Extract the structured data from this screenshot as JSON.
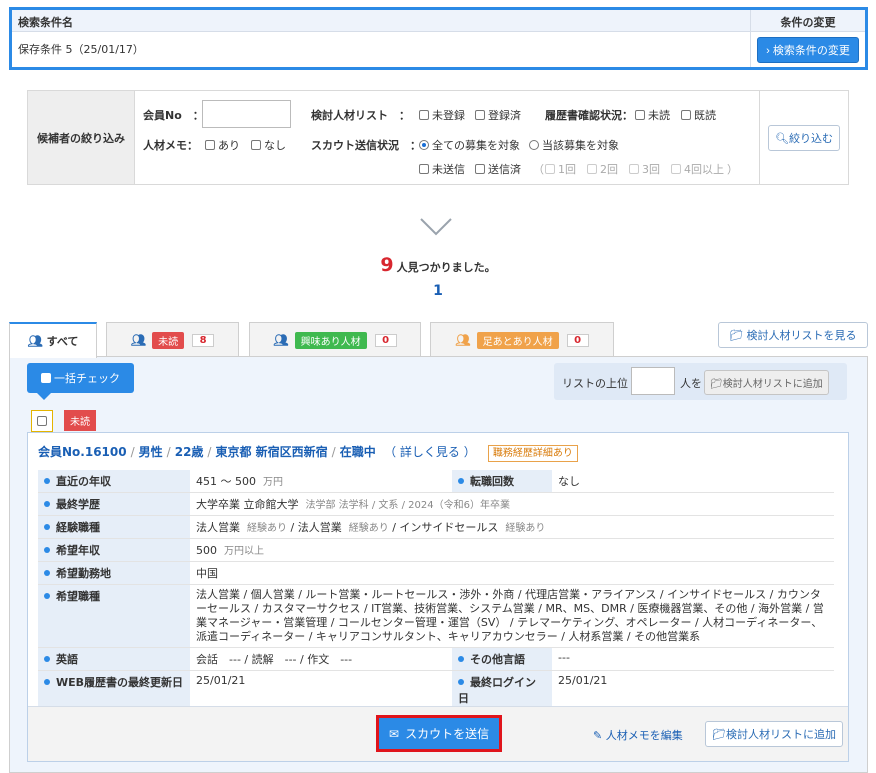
{
  "conditions": {
    "header_name": "検索条件名",
    "header_change": "条件の変更",
    "saved_name": "保存条件 5（25/01/17）",
    "change_button": "› 検索条件の変更"
  },
  "filter": {
    "title": "候補者の絞り込み",
    "member_no_label": "会員No　：",
    "review_list_label": "検討人材リスト　：",
    "unregistered": "未登録",
    "registered": "登録済",
    "resume_status_label": "履歴書確認状況：",
    "unread": "未読",
    "read": "既読",
    "memo_label": "人材メモ：",
    "memo_yes": "あり",
    "memo_no": "なし",
    "scout_status_label": "スカウト送信状況　：",
    "all_jobs": "全ての募集を対象",
    "this_job": "当該募集を対象",
    "not_sent": "未送信",
    "sent": "送信済",
    "paren_open": "（",
    "once": "1回",
    "twice": "2回",
    "three": "3回",
    "four_plus": "4回以上",
    "paren_close": "）",
    "filter_button": "絞り込む"
  },
  "results": {
    "count": "9",
    "found_text": "人見つかりました。",
    "page": "1"
  },
  "tabs": [
    {
      "label": "すべて"
    },
    {
      "badge": "未読",
      "count": "8",
      "badge_color": "#e24c4c"
    },
    {
      "badge": "興味あり人材",
      "count": "0",
      "badge_color": "#3fb94f"
    },
    {
      "badge": "足あとあり人材",
      "count": "0",
      "badge_color": "#f0a24a"
    }
  ],
  "list_link": "検討人材リストを見る",
  "bulk_check": "一括チェック",
  "toplist": {
    "prefix": "リストの上位",
    "suffix": "人を",
    "add_button": "検討人材リストに追加"
  },
  "candidate": {
    "unread_badge": "未読",
    "member_no": "会員No.16100",
    "gender": "男性",
    "age": "22歳",
    "location": "東京都 新宿区西新宿",
    "status": "在職中",
    "details_link": "（ 詳しく見る ）",
    "history_tag": "職務経歴詳細あり",
    "rows": {
      "income_label": "直近の年収",
      "income_value": "451 ～ 500",
      "income_unit": "万円",
      "job_changes_label": "転職回数",
      "job_changes_value": "なし",
      "education_label": "最終学歴",
      "education_value": "大学卒業 立命館大学",
      "education_sub": "法学部 法学科 / 文系 / 2024（令和6）年卒業",
      "experience_label": "経験職種",
      "exp1": "法人営業",
      "exp1_sub": "経験あり",
      "exp2": "法人営業",
      "exp2_sub": "経験あり",
      "exp3": "インサイドセールス",
      "exp3_sub": "経験あり",
      "desired_income_label": "希望年収",
      "desired_income_value": "500",
      "desired_income_unit": "万円以上",
      "desired_location_label": "希望勤務地",
      "desired_location_value": "中国",
      "desired_job_label": "希望職種",
      "desired_job_value": "法人営業 / 個人営業 / ルート営業・ルートセールス・渉外・外商 / 代理店営業・アライアンス / インサイドセールス / カウンターセールス / カスタマーサクセス / IT営業、技術営業、システム営業 / MR、MS、DMR / 医療機器営業、その他 / 海外営業 / 営業マネージャー・営業管理 / コールセンター管理・運営（SV） / テレマーケティング、オペレーター / 人材コーディネーター、派遣コーディネーター / キャリアコンサルタント、キャリアカウンセラー / 人材系営業 / その他営業系",
      "english_label": "英語",
      "english_value": "会話　--- / 読解　--- / 作文　---",
      "other_lang_label": "その他言語",
      "other_lang_value": "---",
      "resume_updated_label": "WEB履歴書の最終更新日",
      "resume_updated_value": "25/01/21",
      "last_login_label": "最終ログイン日",
      "last_login_value": "25/01/21"
    },
    "scout_button": "スカウトを送信",
    "memo_link": "人材メモを編集",
    "add_button": "検討人材リストに追加"
  }
}
